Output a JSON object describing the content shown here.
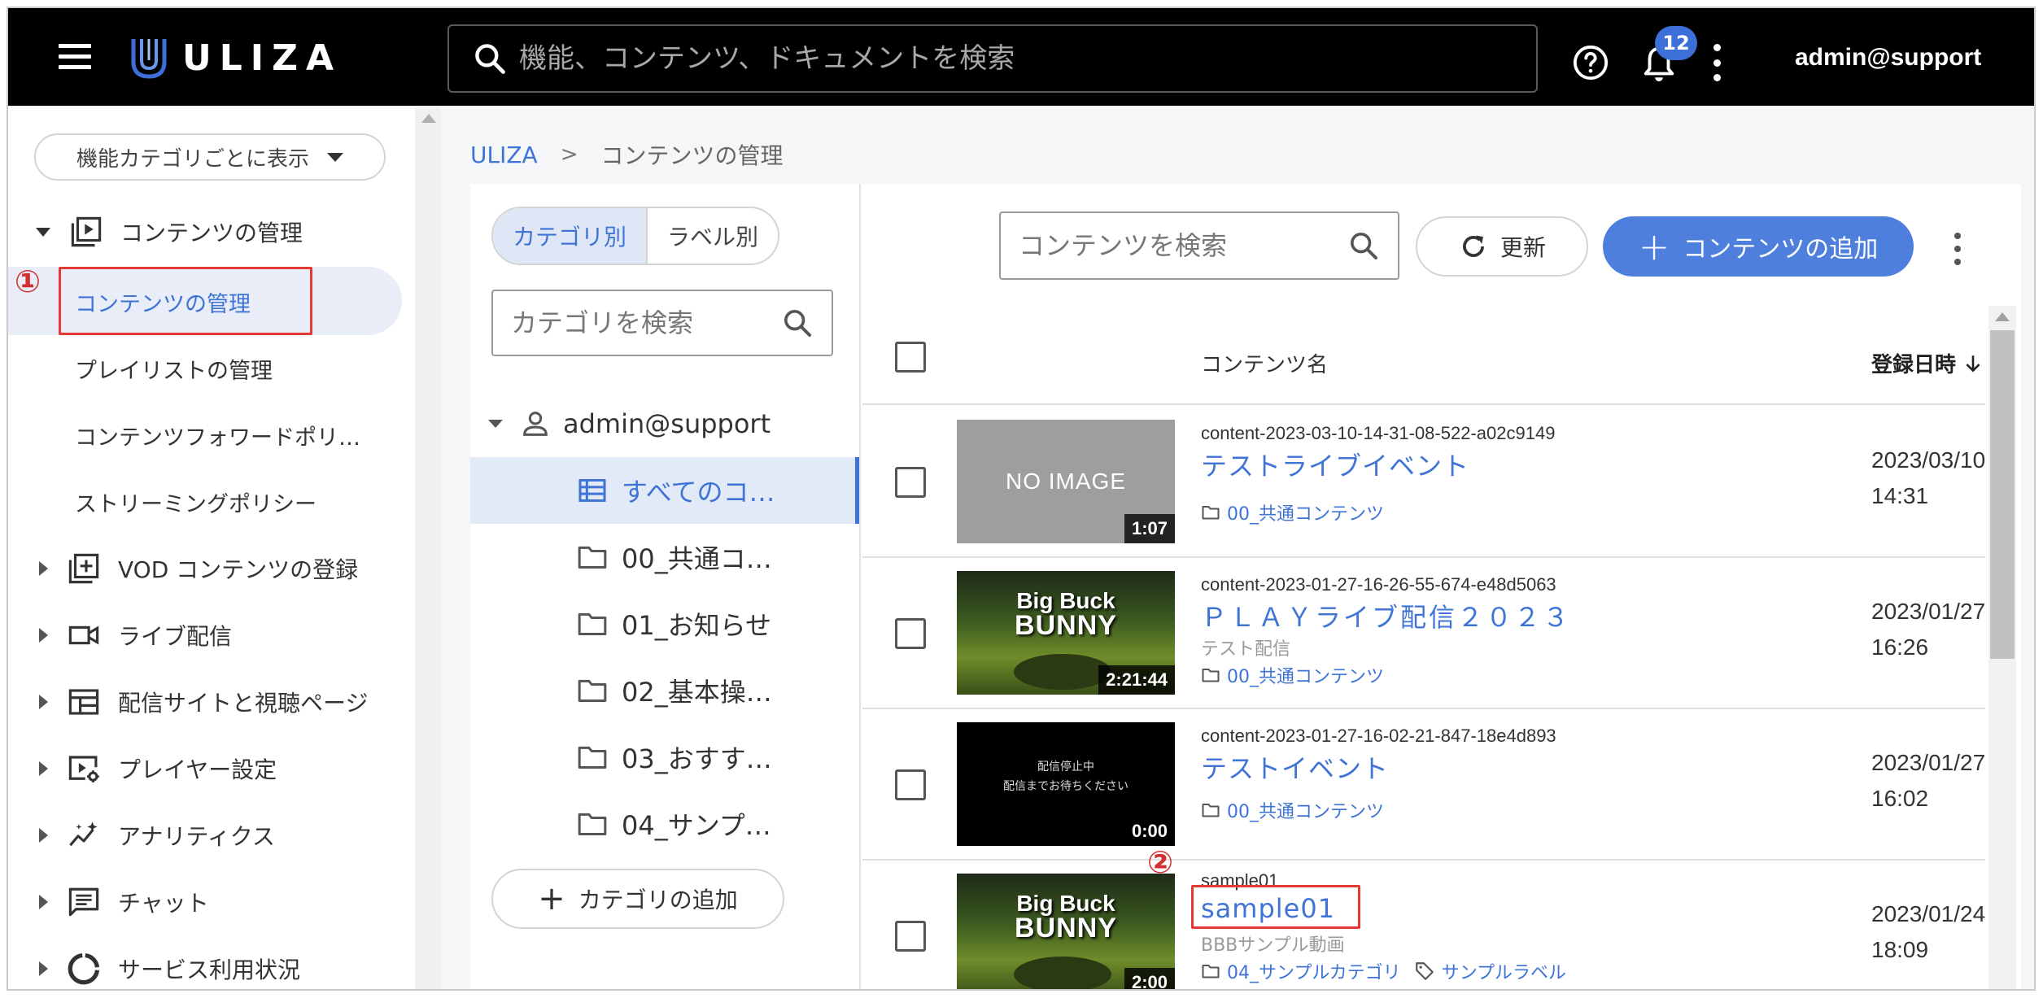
{
  "topbar": {
    "logo_text": "ULIZA",
    "search_placeholder": "機能、コンテンツ、ドキュメントを検索",
    "notification_count": "12",
    "user": "admin@support",
    "bg_color": "#000000",
    "accent_color": "#3d6fd8"
  },
  "sidebar": {
    "category_select": "機能カテゴリごとに表示",
    "groups": [
      {
        "label": "コンテンツの管理",
        "expanded": true,
        "icon": "play-box-icon"
      },
      {
        "label": "VOD コンテンツの登録",
        "expanded": false,
        "icon": "library-add-icon"
      },
      {
        "label": "ライブ配信",
        "expanded": false,
        "icon": "video-camera-icon"
      },
      {
        "label": "配信サイトと視聴ページ",
        "expanded": false,
        "icon": "web-layout-icon"
      },
      {
        "label": "プレイヤー設定",
        "expanded": false,
        "icon": "player-settings-icon"
      },
      {
        "label": "アナリティクス",
        "expanded": false,
        "icon": "analytics-icon"
      },
      {
        "label": "チャット",
        "expanded": false,
        "icon": "chat-icon"
      },
      {
        "label": "サービス利用状況",
        "expanded": false,
        "icon": "donut-icon"
      }
    ],
    "sub_items": [
      {
        "label": "コンテンツの管理",
        "active": true
      },
      {
        "label": "プレイリストの管理",
        "active": false
      },
      {
        "label": "コンテンツフォワードポリ…",
        "active": false
      },
      {
        "label": "ストリーミングポリシー",
        "active": false
      }
    ]
  },
  "annotations": {
    "marker_1": "①",
    "marker_2": "②"
  },
  "breadcrumb": {
    "root": "ULIZA",
    "separator": ">",
    "current": "コンテンツの管理"
  },
  "category_panel": {
    "tabs": [
      {
        "label": "カテゴリ別",
        "active": true
      },
      {
        "label": "ラベル別",
        "active": false
      }
    ],
    "search_placeholder": "カテゴリを検索",
    "root_user": "admin@support",
    "items": [
      {
        "label": "すべてのコ…",
        "selected": true
      },
      {
        "label": "00_共通コ…",
        "selected": false
      },
      {
        "label": "01_お知らせ",
        "selected": false
      },
      {
        "label": "02_基本操…",
        "selected": false
      },
      {
        "label": "03_おすす…",
        "selected": false
      },
      {
        "label": "04_サンプ…",
        "selected": false
      }
    ],
    "add_label": "カテゴリの追加"
  },
  "content_panel": {
    "search_placeholder": "コンテンツを検索",
    "refresh_label": "更新",
    "add_label": "コンテンツの追加",
    "columns": {
      "name": "コンテンツ名",
      "date": "登録日時"
    },
    "rows": [
      {
        "id": "content-2023-03-10-14-31-08-522-a02c9149",
        "title": "テストライブイベント",
        "description": "",
        "folder": "00_共通コンテンツ",
        "label": "",
        "duration": "1:07",
        "thumb_type": "noimage",
        "thumb_text": "NO IMAGE",
        "date": "2023/03/10",
        "time": "14:31"
      },
      {
        "id": "content-2023-01-27-16-26-55-674-e48d5063",
        "title": "ＰＬＡＹライブ配信２０２３",
        "description": "テスト配信",
        "folder": "00_共通コンテンツ",
        "label": "",
        "duration": "2:21:44",
        "thumb_type": "bunny",
        "thumb_text_1": "Big Buck",
        "thumb_text_2": "BUNNY",
        "date": "2023/01/27",
        "time": "16:26"
      },
      {
        "id": "content-2023-01-27-16-02-21-847-18e4d893",
        "title": "テストイベント",
        "description": "",
        "folder": "00_共通コンテンツ",
        "label": "",
        "duration": "0:00",
        "thumb_type": "black",
        "thumb_text_1": "配信停止中",
        "thumb_text_2": "配信までお待ちください",
        "date": "2023/01/27",
        "time": "16:02"
      },
      {
        "id": "sample01",
        "title": "sample01",
        "description": "BBBサンプル動画",
        "folder": "04_サンプルカテゴリ",
        "label": "サンプルラベル",
        "duration": "2:00",
        "thumb_type": "bunny",
        "thumb_text_1": "Big Buck",
        "thumb_text_2": "BUNNY",
        "date": "2023/01/24",
        "time": "18:09"
      }
    ]
  }
}
